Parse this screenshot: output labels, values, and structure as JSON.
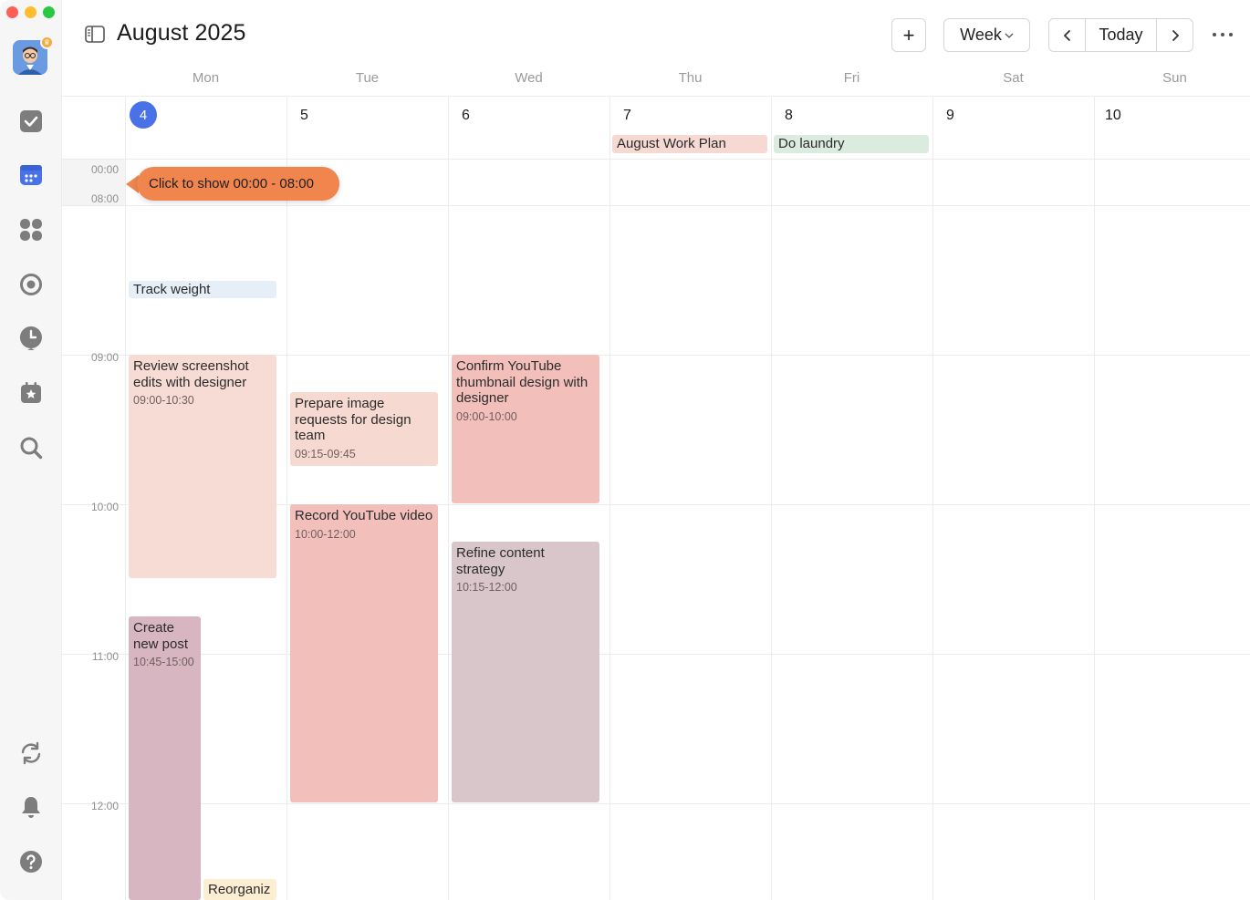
{
  "header": {
    "title": "August 2025",
    "add_label": "+",
    "view_label": "Week",
    "today_label": "Today"
  },
  "weekdays": [
    "Mon",
    "Tue",
    "Wed",
    "Thu",
    "Fri",
    "Sat",
    "Sun"
  ],
  "dates": [
    "4",
    "5",
    "6",
    "7",
    "8",
    "9",
    "10"
  ],
  "all_day_events": [
    {
      "day": "Thu",
      "title": "August Work Plan",
      "color": "#f6d9d3"
    },
    {
      "day": "Fri",
      "title": "Do laundry",
      "color": "#dcebe0"
    }
  ],
  "time_labels": {
    "t0000": "00:00",
    "t0800": "08:00",
    "t0900": "09:00",
    "t1000": "10:00",
    "t1100": "11:00",
    "t1200": "12:00"
  },
  "tooltip": "Click to show 00:00 - 08:00",
  "events": [
    {
      "day": "Mon",
      "title": "Track weight",
      "time": "",
      "color": "#e6eef8"
    },
    {
      "day": "Mon",
      "title": "Review screenshot edits with designer",
      "time": "09:00-10:30",
      "color": "#f6dcd5"
    },
    {
      "day": "Mon",
      "title": "Create new post",
      "time": "10:45-15:00",
      "color": "#d8b6c1"
    },
    {
      "day": "Mon",
      "title": "Reorganiz",
      "time": "",
      "color": "#fbeed2"
    },
    {
      "day": "Tue",
      "title": "Prepare image requests for design team",
      "time": "09:15-09:45",
      "color": "#f6d9d1"
    },
    {
      "day": "Tue",
      "title": "Record YouTube video",
      "time": "10:00-12:00",
      "color": "#f2bfba"
    },
    {
      "day": "Wed",
      "title": "Confirm YouTube thumbnail design with designer",
      "time": "09:00-10:00",
      "color": "#f2bfba"
    },
    {
      "day": "Wed",
      "title": "Refine content strategy",
      "time": "10:15-12:00",
      "color": "#d8c6cb"
    }
  ],
  "colors": {
    "accent": "#4a72e8",
    "tooltip": "#f0854e"
  }
}
